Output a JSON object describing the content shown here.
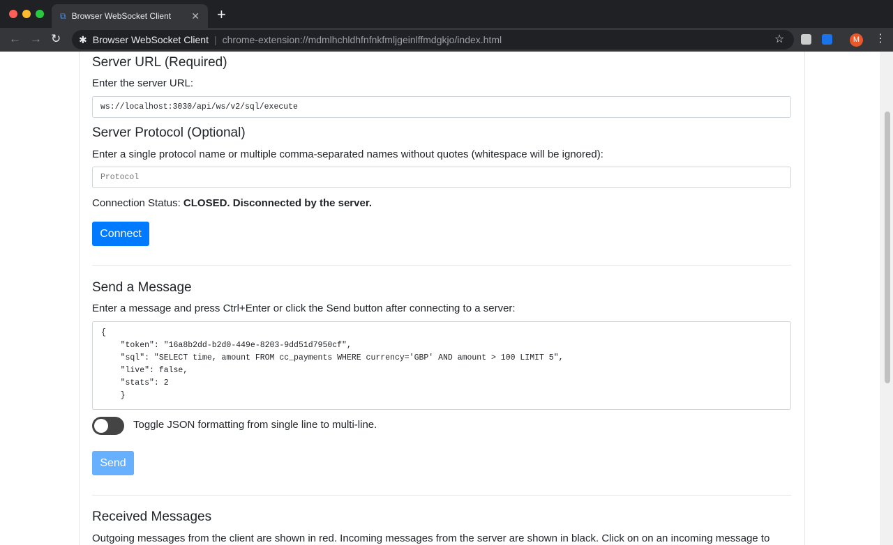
{
  "browser": {
    "tab_title": "Browser WebSocket Client",
    "new_tab": "+",
    "omnibox_title": "Browser WebSocket Client",
    "url": "chrome-extension://mdmlhchldhfnfnkfmljgeinlffmdgkjo/index.html",
    "avatar_letter": "M"
  },
  "server": {
    "heading": "Server URL (Required)",
    "label": "Enter the server URL:",
    "url_value": "ws://localhost:3030/api/ws/v2/sql/execute"
  },
  "protocol": {
    "heading": "Server Protocol (Optional)",
    "label": "Enter a single protocol name or multiple comma-separated names without quotes (whitespace will be ignored):",
    "placeholder": "Protocol"
  },
  "status": {
    "label": "Connection Status: ",
    "value": "CLOSED. Disconnected by the server."
  },
  "connect_label": "Connect",
  "send": {
    "heading": "Send a Message",
    "label": "Enter a message and press Ctrl+Enter or click the Send button after connecting to a server:",
    "message": "{\n    \"token\": \"16a8b2dd-b2d0-449e-8203-9dd51d7950cf\",\n    \"sql\": \"SELECT time, amount FROM cc_payments WHERE currency='GBP' AND amount > 100 LIMIT 5\",\n    \"live\": false,\n    \"stats\": 2\n    }",
    "toggle_label": "Toggle JSON formatting from single line to multi-line.",
    "send_label": "Send"
  },
  "received": {
    "heading": "Received Messages",
    "description": "Outgoing messages from the client are shown in red. Incoming messages from the server are shown in black. Click on on an incoming message to"
  },
  "colors": {
    "primary": "#007bff",
    "disabled": "#66b0ff"
  }
}
